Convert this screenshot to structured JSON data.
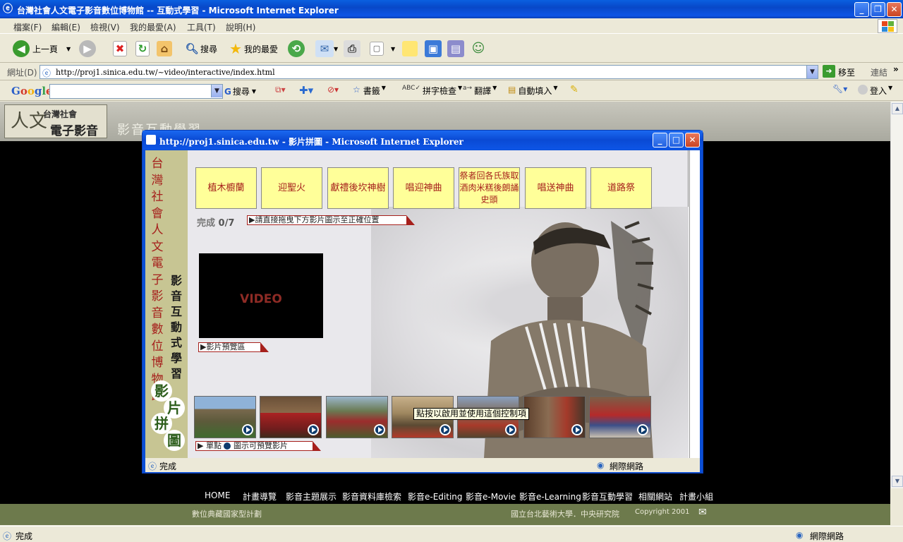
{
  "window": {
    "title": "台灣社會人文電子影音數位博物館 -- 互動式學習 - Microsoft Internet Explorer"
  },
  "menu": [
    "檔案(F)",
    "編輯(E)",
    "檢視(V)",
    "我的最愛(A)",
    "工具(T)",
    "說明(H)"
  ],
  "toolbar": {
    "back_label": "上一頁",
    "search_label": "搜尋",
    "favorites_label": "我的最愛"
  },
  "address": {
    "label": "網址(D)",
    "url": "http://proj1.sinica.edu.tw/~video/interactive/index.html",
    "go_label": "移至",
    "links_label": "連結"
  },
  "googlebar": {
    "logo": "Google",
    "search_label": "搜尋",
    "bookmarks_label": "書籤",
    "spellcheck_label": "拼字檢查",
    "translate_label": "翻譯",
    "autofill_label": "自動填入",
    "signin_label": "登入"
  },
  "site": {
    "logo_char": "人文",
    "logo_small": "台灣社會",
    "logo_main": "電子影音",
    "subtitle": "影音互動學習",
    "nav": [
      "HOME",
      "計畫導覽",
      "影音主題展示",
      "影音資料庫檢索",
      "影音e-Editing",
      "影音e-Movie",
      "影音e-Learning",
      "影音互動學習",
      "相關網站",
      "計畫小組"
    ],
    "footer_left": "數位典藏國家型計劃",
    "footer_right": "國立台北藝術大學．中央研究院",
    "copyright": "Copyright 2001"
  },
  "popup": {
    "title": "http://proj1.sinica.edu.tw - 影片拼圖 - Microsoft Internet Explorer",
    "status": "完成",
    "zone": "網際網路",
    "vertical_title": "台灣社會人文電子影音數位博物館",
    "vertical_subtitle": "影音互動式學習",
    "puzzle_chars": [
      "影",
      "片",
      "拼",
      "圖"
    ],
    "slots": [
      "植木櫥蘭",
      "迎聖火",
      "獻禮後坎神樹",
      "唱迎神曲",
      "祭者回各氏族取酒肉米糕後朗誦史頭",
      "唱送神曲",
      "道路祭"
    ],
    "progress_label": "完成",
    "progress_value": "0/7",
    "instruction": "▶請直接拖曳下方影片圖示至正確位置",
    "video_label": "VIDEO",
    "preview_label": "▶影片預覽區",
    "thumb_hint": "▶ 單點",
    "thumb_hint2": "圖示可預覽影片",
    "tooltip": "點按以啟用並使用這個控制項"
  },
  "status": {
    "text": "完成",
    "zone": "網際網路"
  }
}
